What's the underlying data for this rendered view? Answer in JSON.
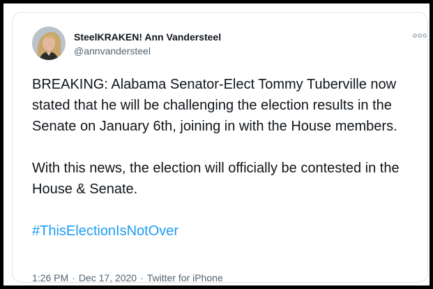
{
  "tweet": {
    "display_name": "SteelKRAKEN! Ann Vandersteel",
    "handle": "@annvandersteel",
    "more_icon": "more-horizontal-icon",
    "paragraphs": [
      "BREAKING: Alabama Senator-Elect Tommy Tuberville now stated that he will be challenging the election results in the Senate on January 6th, joining in with the House members.",
      "With this news, the election will officially be contested in the House & Senate."
    ],
    "hashtag": "#ThisElectionIsNotOver",
    "time": "1:26 PM",
    "separator": "·",
    "date": "Dec 17, 2020",
    "source": "Twitter for iPhone"
  },
  "colors": {
    "frame_border": "#000000",
    "hashtag": "#1d9bf0",
    "secondary_text": "#536471",
    "primary_text": "#0f1419"
  }
}
